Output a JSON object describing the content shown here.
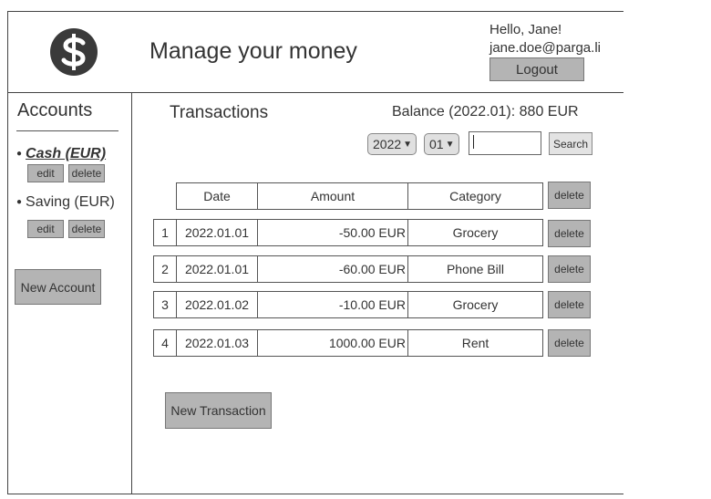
{
  "header": {
    "title": "Manage your money",
    "greeting": "Hello, Jane!",
    "email": "jane.doe@parga.li",
    "logout_label": "Logout",
    "logo_icon": "dollar-sign-icon"
  },
  "sidebar": {
    "title": "Accounts",
    "accounts": [
      {
        "label": "Cash (EUR)",
        "selected": true,
        "edit_label": "edit",
        "delete_label": "delete"
      },
      {
        "label": "Saving (EUR)",
        "selected": false,
        "edit_label": "edit",
        "delete_label": "delete"
      }
    ],
    "new_account_label": "New Account"
  },
  "main": {
    "title": "Transactions",
    "balance": "Balance (2022.01): 880 EUR",
    "filters": {
      "year": "2022",
      "month": "01",
      "search_value": "",
      "search_label": "Search"
    },
    "table": {
      "columns": [
        "Date",
        "Amount",
        "Category"
      ],
      "header_delete_label": "delete",
      "rows": [
        {
          "num": "1",
          "date": "2022.01.01",
          "amount": "-50.00 EUR",
          "category": "Grocery",
          "delete_label": "delete"
        },
        {
          "num": "2",
          "date": "2022.01.01",
          "amount": "-60.00 EUR",
          "category": "Phone Bill",
          "delete_label": "delete"
        },
        {
          "num": "3",
          "date": "2022.01.02",
          "amount": "-10.00 EUR",
          "category": "Grocery",
          "delete_label": "delete"
        },
        {
          "num": "4",
          "date": "2022.01.03",
          "amount": "1000.00 EUR",
          "category": "Rent",
          "delete_label": "delete"
        }
      ]
    },
    "new_transaction_label": "New Transaction"
  }
}
